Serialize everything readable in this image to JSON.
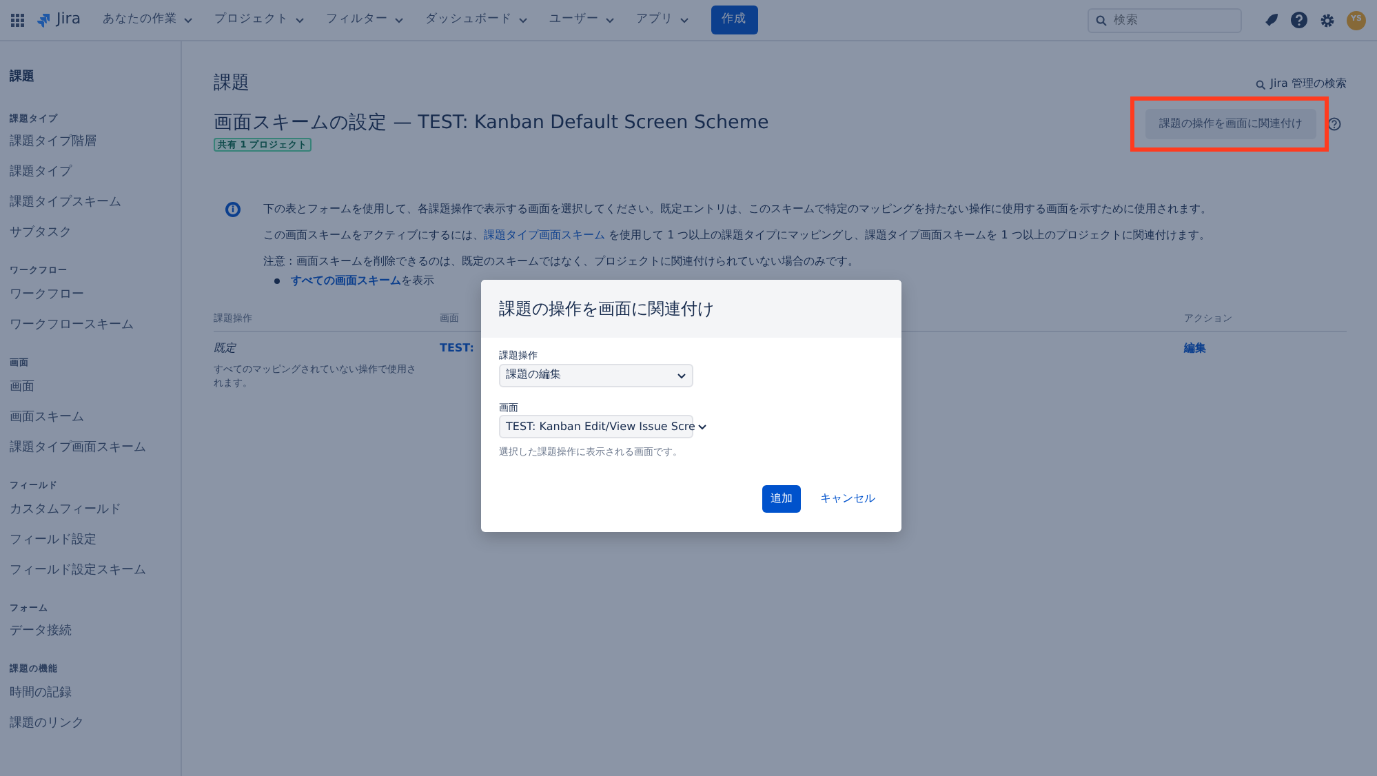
{
  "topbar": {
    "app_name": "Jira",
    "menus": [
      {
        "label": "あなたの作業"
      },
      {
        "label": "プロジェクト"
      },
      {
        "label": "フィルター"
      },
      {
        "label": "ダッシュボード"
      },
      {
        "label": "ユーザー"
      },
      {
        "label": "アプリ"
      }
    ],
    "create_button": "作成",
    "search": {
      "placeholder": "検索"
    },
    "avatar": "YS"
  },
  "sidebar": {
    "title": "課題",
    "groups": [
      {
        "heading": "課題タイプ",
        "items": [
          "課題タイプ階層",
          "課題タイプ",
          "課題タイプスキーム",
          "サブタスク"
        ]
      },
      {
        "heading": "ワークフロー",
        "items": [
          "ワークフロー",
          "ワークフロースキーム"
        ]
      },
      {
        "heading": "画面",
        "items": [
          "画面",
          "画面スキーム",
          "課題タイプ画面スキーム"
        ]
      },
      {
        "heading": "フィールド",
        "items": [
          "カスタムフィールド",
          "フィールド設定",
          "フィールド設定スキーム"
        ]
      },
      {
        "heading": "フォーム",
        "items": [
          "データ接続"
        ]
      },
      {
        "heading": "課題の機能",
        "items": [
          "時間の記録",
          "課題のリンク"
        ]
      }
    ]
  },
  "page": {
    "section_title": "課題",
    "admin_search_link": "Jira 管理の検索",
    "heading": "画面スキームの設定 — TEST: Kanban Default Screen Scheme",
    "shared_badge": "共有 1 プロジェクト",
    "associate_button": {
      "label": "課題の操作を画面に関連付け",
      "highlighted": true
    },
    "info": [
      {
        "before": "下の表とフォームを使用して、各課題操作で表示する画面を選択してください。既定エントリは、このスキームで特定のマッピングを持たない操作に使用する画面を示すために使用されます。"
      },
      {
        "before": "この画面スキームをアクティブにするには、",
        "link": "課題タイプ画面スキーム",
        "after": " を使用して 1 つ以上の課題タイプにマッピングし、課題タイプ画面スキームを 1 つ以上のプロジェクトに関連付けます。"
      },
      {
        "before": "注意 : 画面スキームを削除できるのは、既定のスキームではなく、プロジェクトに関連付けられていない場合のみです。"
      }
    ],
    "bullet": {
      "link": "すべての画面スキーム",
      "after": "を表示"
    },
    "table": {
      "columns": [
        "課題操作",
        "画面",
        "アクション"
      ],
      "rows": [
        {
          "operation": "既定",
          "description": "すべてのマッピングされていない操作で使用されます。",
          "screen": "TEST:",
          "action": "編集"
        }
      ]
    }
  },
  "modal": {
    "title": "課題の操作を画面に関連付け",
    "fields": [
      {
        "label": "課題操作",
        "value": "課題の編集"
      },
      {
        "label": "画面",
        "value": "TEST: Kanban Edit/View Issue Scre",
        "help": "選択した課題操作に表示される画面です。"
      }
    ],
    "submit": "追加",
    "cancel": "キャンセル"
  }
}
